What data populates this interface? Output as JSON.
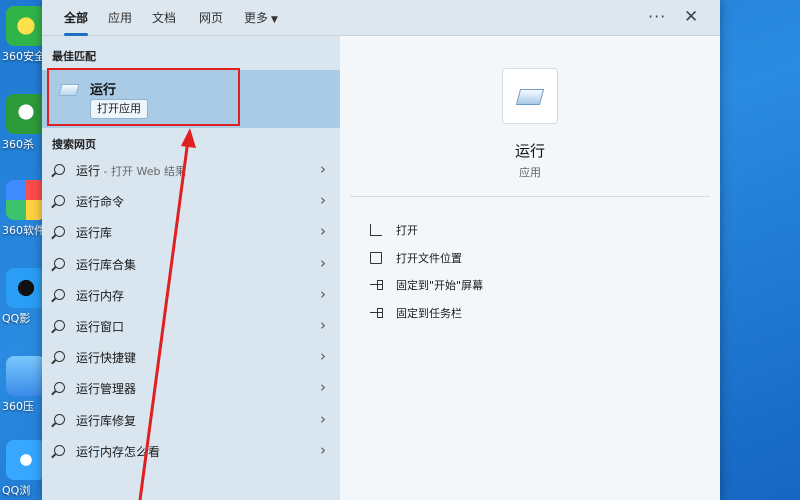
{
  "desktop": {
    "icons": [
      {
        "label": "360安全",
        "icon": "360-safe-icon"
      },
      {
        "label": "360杀",
        "icon": "360-antivirus-icon"
      },
      {
        "label": "360软件",
        "icon": "360-software-icon"
      },
      {
        "label": "QQ影",
        "icon": "qq-player-icon"
      },
      {
        "label": "360压",
        "icon": "360-zip-icon"
      },
      {
        "label": "QQ浏",
        "icon": "qq-browser-icon"
      }
    ]
  },
  "tabs": {
    "all": "全部",
    "apps": "应用",
    "docs": "文档",
    "web": "网页",
    "more": "更多",
    "more_icon": "···",
    "close_icon": "✕"
  },
  "left": {
    "best_match_title": "最佳匹配",
    "best_match": {
      "name": "运行",
      "button": "打开应用"
    },
    "web_section_title": "搜索网页",
    "results": [
      {
        "label": "运行",
        "suffix": " - 打开 Web 结果"
      },
      {
        "label": "运行命令",
        "suffix": ""
      },
      {
        "label": "运行库",
        "suffix": ""
      },
      {
        "label": "运行库合集",
        "suffix": ""
      },
      {
        "label": "运行内存",
        "suffix": ""
      },
      {
        "label": "运行窗口",
        "suffix": ""
      },
      {
        "label": "运行快捷键",
        "suffix": ""
      },
      {
        "label": "运行管理器",
        "suffix": ""
      },
      {
        "label": "运行库修复",
        "suffix": ""
      },
      {
        "label": "运行内存怎么看",
        "suffix": ""
      }
    ]
  },
  "right": {
    "app_name": "运行",
    "app_type": "应用",
    "actions": [
      {
        "label": "打开",
        "icon": "open-icon"
      },
      {
        "label": "打开文件位置",
        "icon": "folder-icon"
      },
      {
        "label": "固定到\"开始\"屏幕",
        "icon": "pin-icon"
      },
      {
        "label": "固定到任务栏",
        "icon": "pin-icon"
      }
    ]
  },
  "colors": {
    "highlight": "#e02020",
    "selected_bg": "#a9cbe6",
    "accent": "#1b6ec2"
  }
}
